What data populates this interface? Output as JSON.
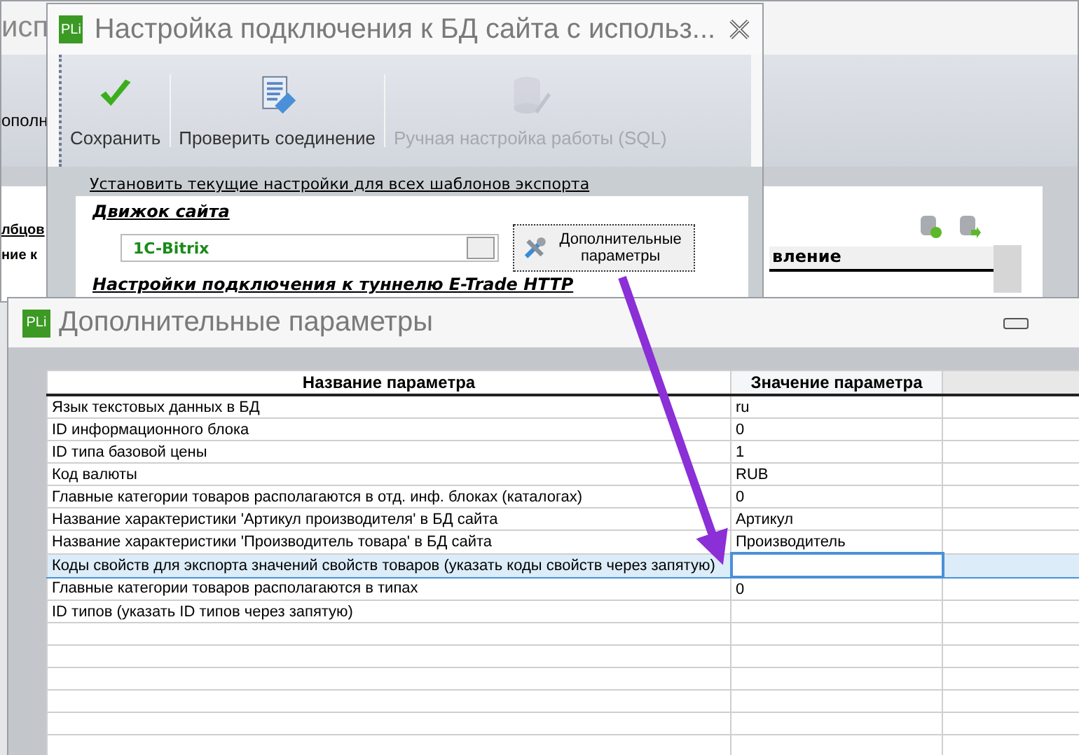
{
  "background_window": {
    "title_fragment": "исп",
    "toolbar_fragment": "ополн",
    "table_fragments": [
      "лбцов",
      "ние к"
    ],
    "column_header_fragment": "вление"
  },
  "settings_window": {
    "logo": "PLi",
    "title": "Настройка подключения к БД сайта с использ...",
    "toolbar": [
      {
        "label": "Сохранить",
        "kind": "check",
        "disabled": false
      },
      {
        "label": "Проверить соединение",
        "kind": "connect",
        "disabled": false
      },
      {
        "label": "Ручная настройка работы (SQL)",
        "kind": "database",
        "disabled": true
      }
    ],
    "apply_all_link": "Установить текущие настройки для всех шаблонов экспорта",
    "engine_label": "Движок сайта",
    "engine_value": "1C-Bitrix",
    "extra_button": "Дополнительные параметры",
    "tunnel_label": "Настройки подключения к туннелю E-Trade HTTP"
  },
  "params_window": {
    "logo": "PLi",
    "title": "Дополнительные параметры",
    "columns": [
      "Название параметра",
      "Значение параметра"
    ],
    "rows": [
      {
        "name": "Язык текстовых данных в БД",
        "value": "ru",
        "selected": false
      },
      {
        "name": "ID информационного блока",
        "value": "0",
        "selected": false
      },
      {
        "name": "ID типа базовой цены",
        "value": "1",
        "selected": false
      },
      {
        "name": "Код валюты",
        "value": "RUB",
        "selected": false
      },
      {
        "name": "Главные категории товаров располагаются в отд. инф. блоках (каталогах)",
        "value": "0",
        "selected": false
      },
      {
        "name": "Название характеристики 'Артикул производителя' в БД сайта",
        "value": "Артикул",
        "selected": false
      },
      {
        "name": "Название характеристики 'Производитель товара' в БД сайта",
        "value": "Производитель",
        "selected": false
      },
      {
        "name": "Коды свойств для экспорта значений свойств товаров (указать коды свойств через запятую)",
        "value": "",
        "selected": true
      },
      {
        "name": "Главные категории товаров располагаются в типах",
        "value": "0",
        "selected": false
      },
      {
        "name": "ID типов (указать ID типов через запятую)",
        "value": "",
        "selected": false
      }
    ]
  }
}
